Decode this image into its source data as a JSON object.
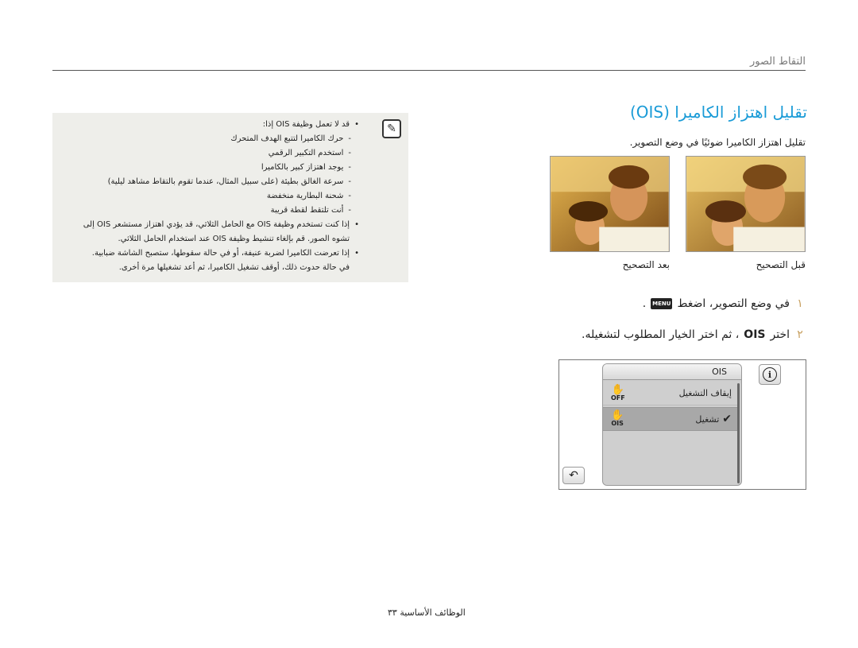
{
  "header": {
    "section_title": "التقاط الصور"
  },
  "page": {
    "title": "تقليل اهتزاز الكاميرا (OIS)",
    "intro": "تقليل اهتزاز الكاميرا ضوئيًا في وضع التصوير."
  },
  "photos": {
    "before_caption": "قبل التصحيح",
    "after_caption": "بعد التصحيح"
  },
  "steps": [
    {
      "num": "١",
      "text": "في وضع التصوير، اضغط",
      "icon": "MENU",
      "suffix": "."
    },
    {
      "num": "٢",
      "text": "اختر",
      "bold": "OIS",
      "rest": "، ثم اختر الخيار المطلوب لتشغيله."
    }
  ],
  "camera_menu": {
    "title": "OIS",
    "options": [
      {
        "label": "إيقاف التشغيل",
        "icon_text": "OFF",
        "selected": false
      },
      {
        "label": "تشغيل",
        "icon_text": "OIS",
        "selected": true
      }
    ],
    "info_glyph": "i",
    "back_glyph": "↶"
  },
  "note": {
    "lines": [
      {
        "kind": "bullet",
        "text": "قد لا تعمل وظيفة OIS إذا:"
      },
      {
        "kind": "dash",
        "text": "حرك الكاميرا لتتبع الهدف المتحرك"
      },
      {
        "kind": "dash",
        "text": "استخدم التكبير الرقمي"
      },
      {
        "kind": "dash",
        "text": "يوجد اهتزاز كبير بالكاميرا"
      },
      {
        "kind": "dash",
        "text": "سرعة الغالق بطيئة (على سبيل المثال، عندما تقوم بالتقاط مشاهد ليلية)"
      },
      {
        "kind": "dash",
        "text": "شحنة البطارية منخفضة"
      },
      {
        "kind": "dash",
        "text": "أنت تلتقط لقطة قريبة"
      },
      {
        "kind": "bullet",
        "text": "إذا كنت تستخدم وظيفة OIS مع الحامل الثلاثي، قد يؤدي اهتزاز مستشعر OIS إلى"
      },
      {
        "kind": "cont",
        "text": "تشوه الصور. قم بإلغاء تنشيط وظيفة OIS عند استخدام الحامل الثلاثي."
      },
      {
        "kind": "bullet",
        "text": "إذا تعرضت الكاميرا لضربة عنيفة، أو في حالة سقوطها، ستصبح الشاشة ضبابية."
      },
      {
        "kind": "cont",
        "text": "في حالة حدوث ذلك، أوقف تشغيل الكاميرا، ثم أعد تشغيلها مرة أخرى."
      }
    ]
  },
  "footer": {
    "text": "الوظائف الأساسية  ٣٣"
  }
}
